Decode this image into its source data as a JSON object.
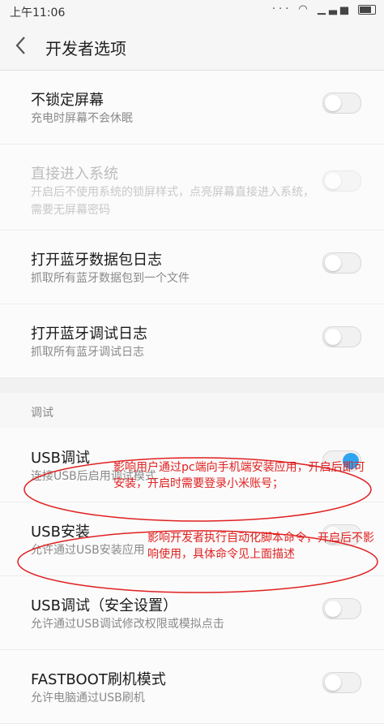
{
  "status": {
    "time": "上午11:06"
  },
  "header": {
    "back_icon": "chevron-left-icon",
    "title": "开发者选项"
  },
  "rows": [
    {
      "title": "不锁定屏幕",
      "sub": "充电时屏幕不会休眠",
      "state": "off"
    },
    {
      "title": "直接进入系统",
      "sub": "开启后不使用系统的锁屏样式，点亮屏幕直接进入系统，需要无屏幕密码",
      "state": "off",
      "disabled": true
    },
    {
      "title": "打开蓝牙数据包日志",
      "sub": "抓取所有蓝牙数据包到一个文件",
      "state": "off"
    },
    {
      "title": "打开蓝牙调试日志",
      "sub": "抓取所有蓝牙调试日志",
      "state": "off"
    }
  ],
  "section": {
    "label": "调试"
  },
  "debug_rows": [
    {
      "title": "USB调试",
      "sub": "连接USB后启用调试模式",
      "state": "on"
    },
    {
      "title": "USB安装",
      "sub": "允许通过USB安装应用",
      "state": "off"
    },
    {
      "title": "USB调试（安全设置）",
      "sub": "允许通过USB调试修改权限或模拟点击",
      "state": "off"
    },
    {
      "title": "FASTBOOT刷机模式",
      "sub": "允许电脑通过USB刷机",
      "state": "off"
    }
  ],
  "annotations": [
    {
      "text": "影响用户通过pc端向手机端安装应用，开启后即可安装，开启时需要登录小米账号；"
    },
    {
      "text": "影响开发者执行自动化脚本命令，开启后不影响使用，具体命令见上面描述"
    }
  ],
  "colors": {
    "accent": "#2ea4f0",
    "annotation": "#e02020"
  }
}
